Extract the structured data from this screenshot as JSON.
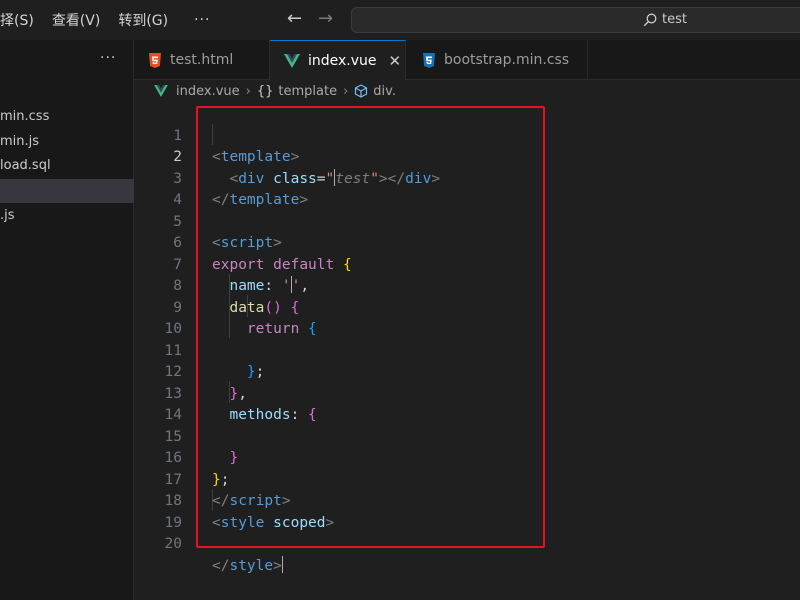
{
  "menu": {
    "items": [
      "选择(S)",
      "查看(V)",
      "转到(G)"
    ],
    "more": "···"
  },
  "command_center": {
    "text": "test"
  },
  "sidebar": {
    "more": "···",
    "files": [
      "min.css",
      "min.js",
      "load.sql",
      "",
      ".js"
    ]
  },
  "tabs": [
    {
      "label": "test.html",
      "icon": "html5-icon"
    },
    {
      "label": "index.vue",
      "icon": "vue-icon"
    },
    {
      "label": "bootstrap.min.css",
      "icon": "css3-icon"
    }
  ],
  "breadcrumb": {
    "file": "index.vue",
    "section": "template",
    "element": "div."
  },
  "editor": {
    "line_numbers": [
      "1",
      "2",
      "3",
      "4",
      "5",
      "6",
      "7",
      "8",
      "9",
      "10",
      "11",
      "12",
      "13",
      "14",
      "15",
      "16",
      "17",
      "18",
      "19",
      "20"
    ],
    "current_line": 2,
    "ghost_text": "test"
  },
  "colors": {
    "accent": "#0078d4",
    "highlight_box": "#e81123",
    "vue": "#41b883",
    "html": "#e44d26",
    "css": "#1572b6"
  }
}
